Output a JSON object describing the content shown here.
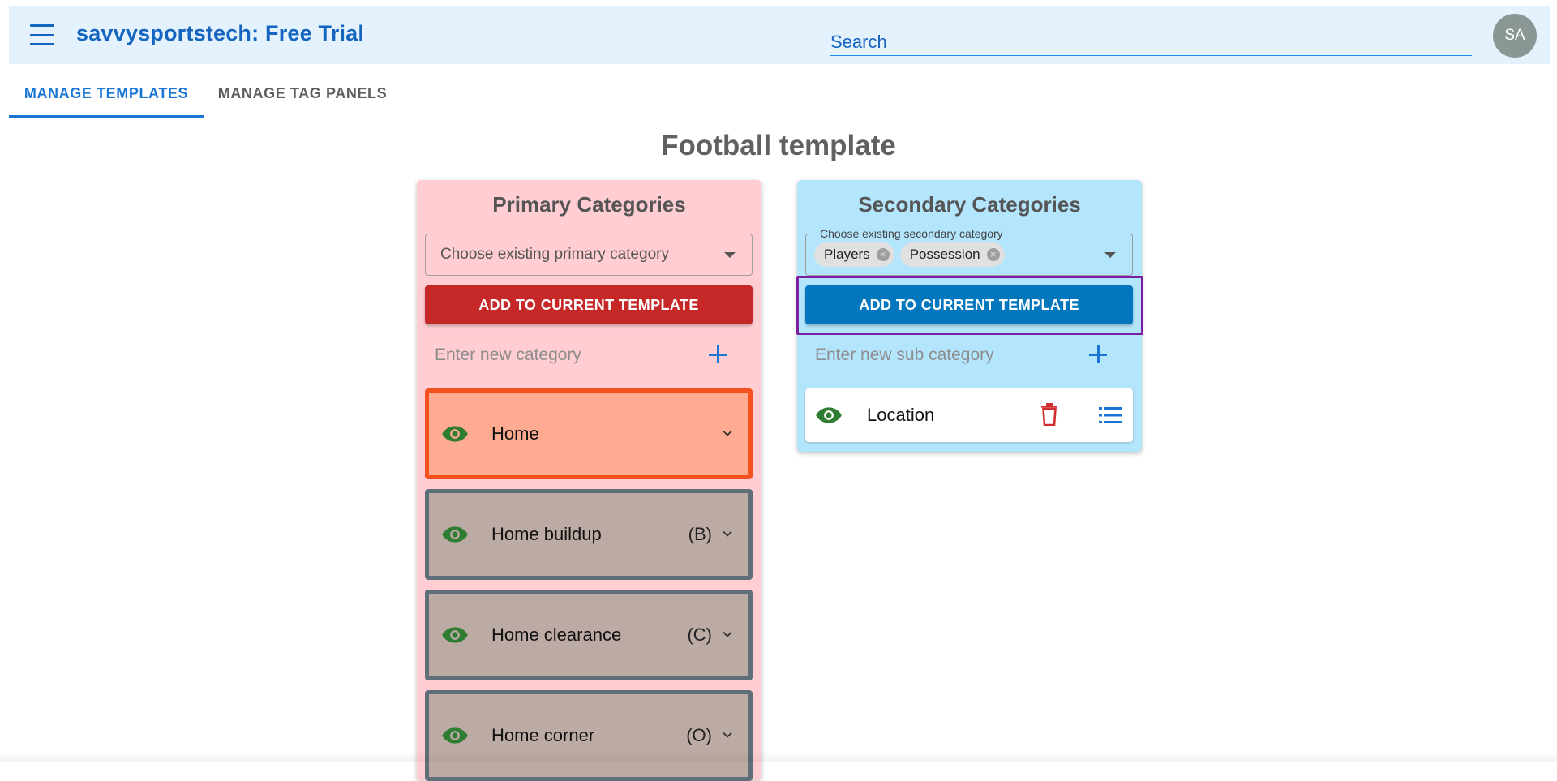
{
  "appbar": {
    "title": "savvysportstech: Free Trial",
    "search_placeholder": "Search",
    "avatar_initials": "SA",
    "icons": {
      "menu": "hamburger-menu-icon"
    }
  },
  "tabs": [
    {
      "label": "MANAGE TEMPLATES",
      "active": true
    },
    {
      "label": "MANAGE TAG PANELS",
      "active": false
    }
  ],
  "page": {
    "title": "Football template"
  },
  "primary": {
    "title": "Primary Categories",
    "select_placeholder": "Choose existing primary category",
    "add_button": "ADD TO CURRENT TEMPLATE",
    "new_placeholder": "Enter new category",
    "items": [
      {
        "name": "Home",
        "key": "",
        "selected": true
      },
      {
        "name": "Home buildup",
        "key": "(B)",
        "selected": false
      },
      {
        "name": "Home clearance",
        "key": "(C)",
        "selected": false
      },
      {
        "name": "Home corner",
        "key": "(O)",
        "selected": false
      }
    ]
  },
  "secondary": {
    "title": "Secondary Categories",
    "select_label": "Choose existing secondary category",
    "chips": [
      "Players",
      "Possession"
    ],
    "add_button": "ADD TO CURRENT TEMPLATE",
    "new_placeholder": "Enter new sub category",
    "items": [
      {
        "name": "Location"
      }
    ]
  },
  "colors": {
    "accent_blue": "#1976d2",
    "primary_panel": "#ffcdd2",
    "secondary_panel": "#b3e5fc",
    "add_red": "#c62828",
    "add_blue": "#0277bd",
    "selected_card": "#ffab91",
    "card": "#bcaaa4",
    "eye_green": "#2e7d32",
    "highlight_purple": "#7b1fa2"
  }
}
